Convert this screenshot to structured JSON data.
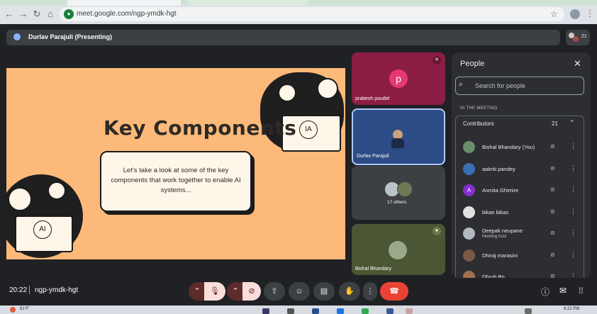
{
  "browser": {
    "url": "meet.google.com/ngp-ymdk-hgt"
  },
  "presenting": {
    "label": "Durlav Parajuli (Presenting)",
    "participant_count": "21"
  },
  "slide": {
    "title": "Key Components",
    "body": "Let’s take a look at some of the key components that work together to enable AI systems...",
    "badge_left": "AI",
    "badge_right": "IA"
  },
  "tiles": [
    {
      "name": "prabesh poudel",
      "avatar_letter": "p",
      "muted": true
    },
    {
      "name": "Durlav Parajuli",
      "muted": false
    },
    {
      "name": "17 others"
    },
    {
      "name": "Bishal Bhandary",
      "muted": false
    }
  ],
  "people_panel": {
    "title": "People",
    "search_placeholder": "Search for people",
    "section_label": "IN THE MEETING",
    "group_label": "Contributors",
    "group_count": "21",
    "participants": [
      {
        "name": "Bishal Bhandary (You)",
        "sub": "",
        "avatar_letter": "",
        "avatar_color": "#6b8e6b"
      },
      {
        "name": "aakriti pandey",
        "sub": "",
        "avatar_letter": "",
        "avatar_color": "#3b6fb6"
      },
      {
        "name": "Asmita Ghimire",
        "sub": "",
        "avatar_letter": "A",
        "avatar_color": "#8430ce"
      },
      {
        "name": "bikas bikas",
        "sub": "",
        "avatar_letter": "",
        "avatar_color": "#e0e0e0"
      },
      {
        "name": "Deepak neupane",
        "sub": "Meeting host",
        "avatar_letter": "",
        "avatar_color": "#b0b8c0"
      },
      {
        "name": "Dhiraj marasini",
        "sub": "",
        "avatar_letter": "",
        "avatar_color": "#7a5a48"
      },
      {
        "name": "Dhrub Bo...",
        "sub": "",
        "avatar_letter": "",
        "avatar_color": "#a07050"
      }
    ]
  },
  "bottom": {
    "time": "20:22",
    "meeting_code": "ngp-ymdk-hgt"
  },
  "taskbar": {
    "temperature": "81°F",
    "clock": "8:22 PM"
  },
  "colors": {
    "slide_bg": "#fdb979",
    "end_call": "#ea4335",
    "muted_control": "#f9dedc"
  }
}
